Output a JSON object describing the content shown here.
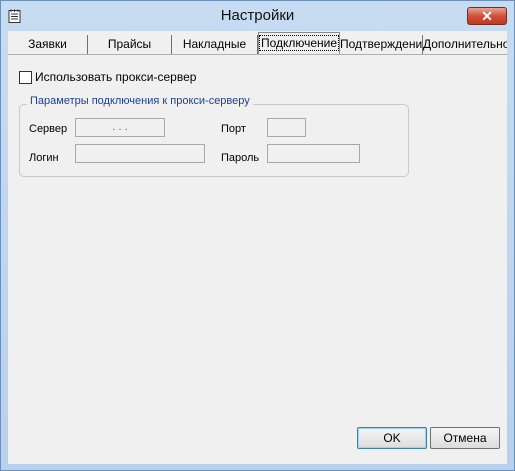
{
  "window": {
    "title": "Настройки",
    "icon": "notepad-icon",
    "close_symbol": "✕"
  },
  "tabs": [
    {
      "label": "Заявки"
    },
    {
      "label": "Прайсы"
    },
    {
      "label": "Накладные"
    },
    {
      "label": "Подключение",
      "selected": true
    },
    {
      "label": "Подтверждения"
    },
    {
      "label": "Дополнительно"
    }
  ],
  "proxy": {
    "use_proxy_label": "Использовать прокси-сервер",
    "use_proxy_checked": false,
    "group_title": "Параметры подключения к прокси-серверу",
    "server_label": "Сервер",
    "server_value": ".   .   .",
    "port_label": "Порт",
    "port_value": "",
    "login_label": "Логин",
    "login_value": "",
    "password_label": "Пароль",
    "password_value": ""
  },
  "buttons": {
    "ok": "OK",
    "cancel": "Отмена"
  },
  "colors": {
    "group_title": "#1c3f95",
    "close_button": "#c1391f"
  }
}
